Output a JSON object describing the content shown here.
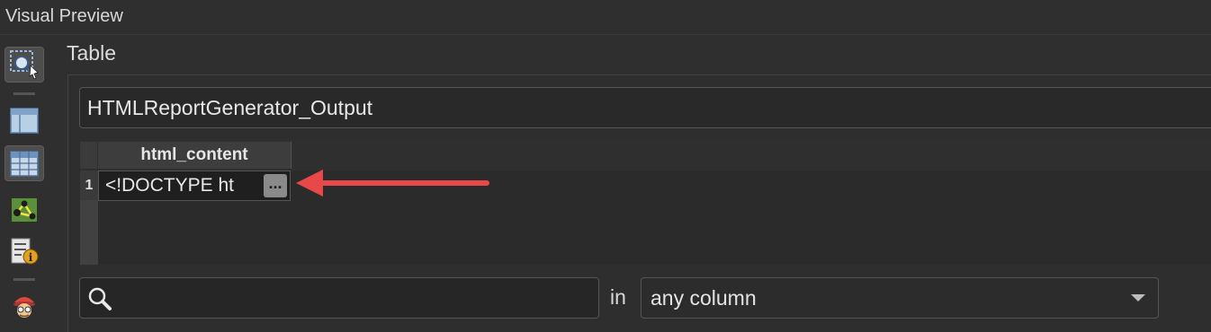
{
  "panel": {
    "title": "Visual Preview"
  },
  "toolbar": {
    "items": [
      {
        "icon": "magnifier-select-icon",
        "active": true
      },
      {
        "icon": "table-layout-icon",
        "active": false
      },
      {
        "icon": "data-grid-icon",
        "active": true
      },
      {
        "icon": "network-graph-icon",
        "active": false
      },
      {
        "icon": "info-list-icon",
        "active": false
      },
      {
        "icon": "inspector-icon",
        "active": false
      }
    ]
  },
  "section": {
    "label": "Table"
  },
  "table_name": {
    "value": "HTMLReportGenerator_Output"
  },
  "grid": {
    "columns": [
      "html_content"
    ],
    "rows": [
      {
        "row_number": "1",
        "html_content": "<!DOCTYPE ht"
      }
    ],
    "cell_overflow_button": "..."
  },
  "annotation": {
    "arrow_color": "#e84848"
  },
  "search": {
    "value": "",
    "in_label": "in"
  },
  "column_filter": {
    "selected": "any column"
  }
}
